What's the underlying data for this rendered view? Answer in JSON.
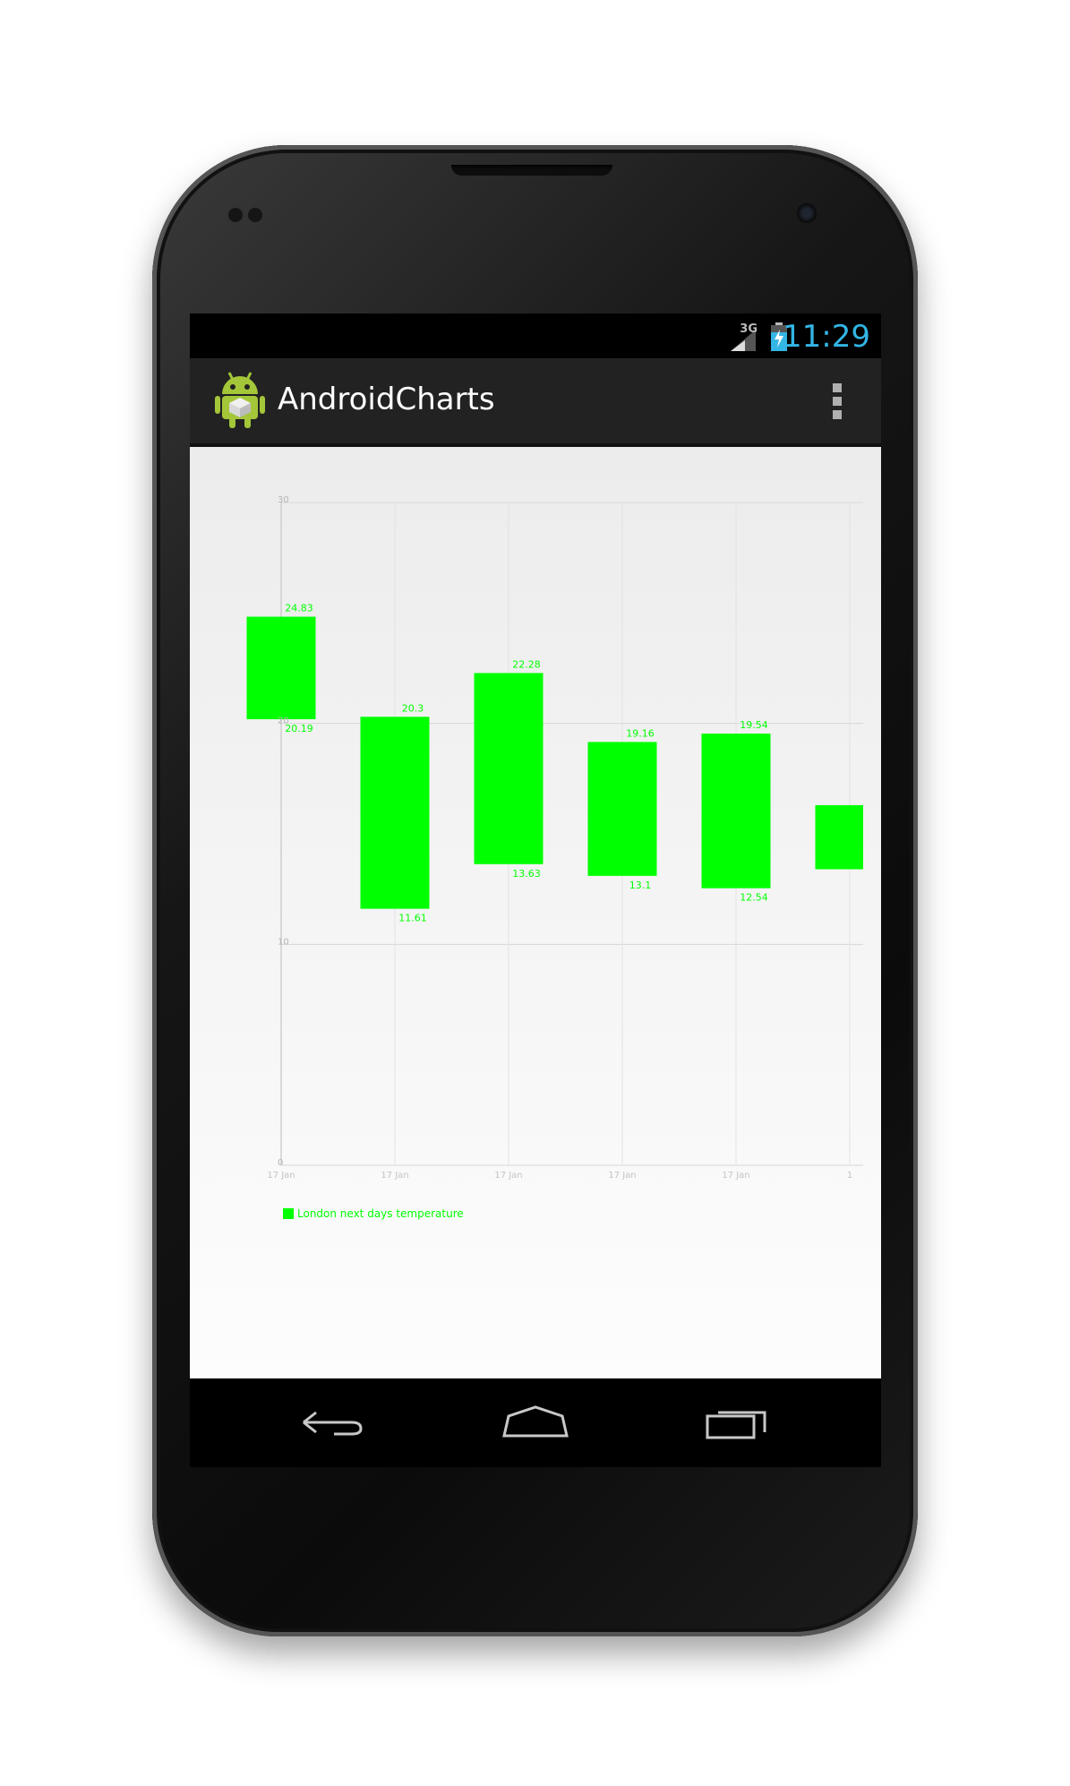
{
  "status_bar": {
    "network": "3G",
    "time": "11:29",
    "time_color": "#33b5e5"
  },
  "action_bar": {
    "title": "AndroidCharts"
  },
  "chart_data": {
    "type": "range-bar",
    "y_ticks": [
      "30",
      "20",
      "10",
      "0"
    ],
    "ylim": [
      0,
      30
    ],
    "x_tick_labels": [
      "17 Jan",
      "17 Jan",
      "17 Jan",
      "17 Jan",
      "17 Jan",
      "1"
    ],
    "series": [
      {
        "name": "London next days temperature",
        "color": "#00ff00",
        "bars": [
          {
            "low": 20.19,
            "high": 24.83,
            "low_label": "20.19",
            "high_label": "24.83"
          },
          {
            "low": 11.61,
            "high": 20.3,
            "low_label": "11.61",
            "high_label": "20.3"
          },
          {
            "low": 13.63,
            "high": 22.28,
            "low_label": "13.63",
            "high_label": "22.28"
          },
          {
            "low": 13.1,
            "high": 19.16,
            "low_label": "13.1",
            "high_label": "19.16"
          },
          {
            "low": 12.54,
            "high": 19.54,
            "low_label": "12.54",
            "high_label": "19.54"
          },
          {
            "low": 13.4,
            "high": 16.3,
            "low_label": "",
            "high_label": ""
          }
        ]
      }
    ],
    "grid": true,
    "legend_position": "bottom-left"
  }
}
